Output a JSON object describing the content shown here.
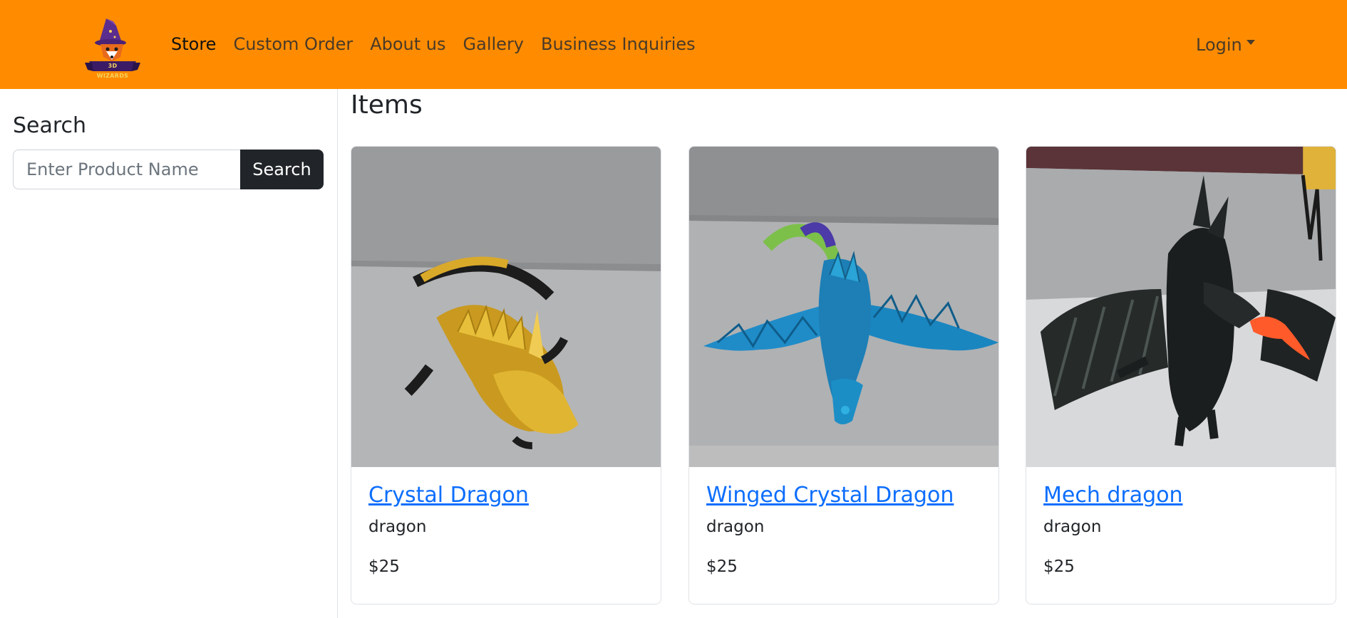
{
  "brand": {
    "logo_text": "3D WIZARDS"
  },
  "nav": {
    "links": [
      {
        "label": "Store",
        "active": true
      },
      {
        "label": "Custom Order",
        "active": false
      },
      {
        "label": "About us",
        "active": false
      },
      {
        "label": "Gallery",
        "active": false
      },
      {
        "label": "Business Inquiries",
        "active": false
      }
    ],
    "login_label": "Login"
  },
  "sidebar": {
    "heading": "Search",
    "search_placeholder": "Enter Product Name",
    "search_button": "Search"
  },
  "main": {
    "heading": "Items",
    "items": [
      {
        "name": "Crystal Dragon",
        "category": "dragon",
        "price": "$25"
      },
      {
        "name": "Winged Crystal Dragon",
        "category": "dragon",
        "price": "$25"
      },
      {
        "name": "Mech dragon",
        "category": "dragon",
        "price": "$25"
      }
    ]
  },
  "colors": {
    "navbar": "#ff8c00",
    "link": "#0d6efd",
    "button_dark": "#212529"
  }
}
